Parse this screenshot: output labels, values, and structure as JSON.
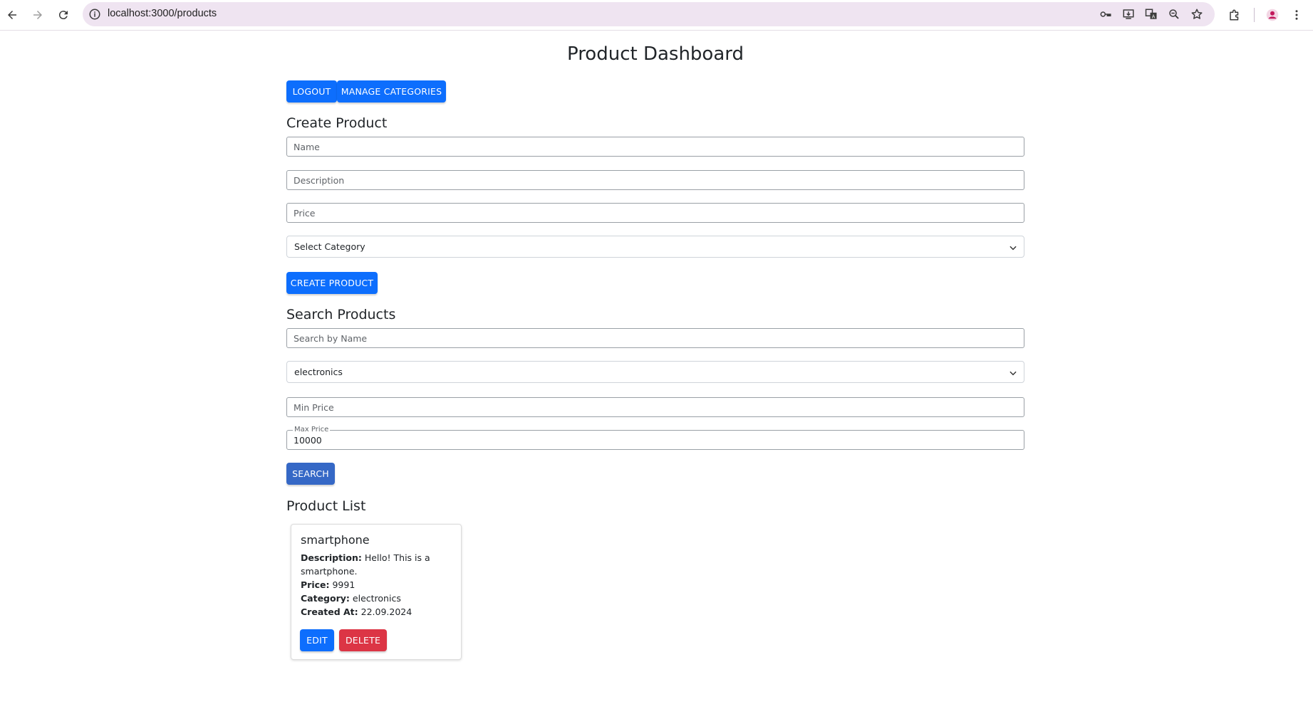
{
  "browser": {
    "url": "localhost:3000/products"
  },
  "page": {
    "title": "Product Dashboard",
    "top_buttons": {
      "logout": "LOGOUT",
      "manage_categories": "MANAGE CATEGORIES"
    },
    "create": {
      "heading": "Create Product",
      "name_placeholder": "Name",
      "description_placeholder": "Description",
      "price_placeholder": "Price",
      "category_select": "Select Category",
      "submit": "CREATE PRODUCT"
    },
    "search": {
      "heading": "Search Products",
      "name_placeholder": "Search by Name",
      "category_value": "electronics",
      "min_price_placeholder": "Min Price",
      "max_price_label": "Max Price",
      "max_price_value": "10000",
      "submit": "SEARCH"
    },
    "list": {
      "heading": "Product List",
      "products": [
        {
          "name": "smartphone",
          "description_label": "Description:",
          "description": "Hello! This is a smartphone.",
          "price_label": "Price:",
          "price": "9991",
          "category_label": "Category:",
          "category": "electronics",
          "created_label": "Created At:",
          "created": "22.09.2024",
          "edit": "EDIT",
          "delete": "DELETE"
        }
      ]
    }
  },
  "colors": {
    "primary": "#0d6efd",
    "search_button": "#3568c6",
    "danger": "#dc3545",
    "omnibox": "#efe4f1",
    "profile": "#c2185b"
  }
}
